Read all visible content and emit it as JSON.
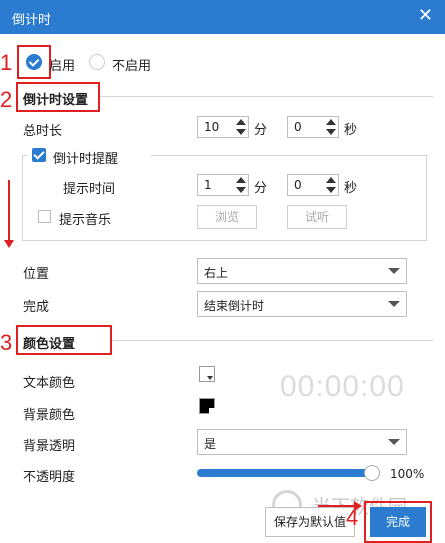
{
  "window": {
    "title": "倒计时",
    "close_glyph": "✕"
  },
  "annotations": {
    "n1": "1",
    "n2": "2",
    "n3": "3",
    "n4": "4"
  },
  "enable": {
    "on_label": "启用",
    "off_label": "不启用"
  },
  "countdown_settings": {
    "title": "倒计时设置",
    "total_label": "总时长",
    "total_min": "10",
    "min_unit": "分",
    "total_sec": "0",
    "sec_unit": "秒",
    "reminder_label": "倒计时提醒",
    "prompt_time_label": "提示时间",
    "prompt_min": "1",
    "prompt_sec": "0",
    "music_label": "提示音乐",
    "browse_label": "浏览",
    "listen_label": "试听",
    "position_label": "位置",
    "position_value": "右上",
    "complete_label": "完成",
    "complete_value": "结束倒计时"
  },
  "color_settings": {
    "title": "颜色设置",
    "text_color_label": "文本颜色",
    "bg_color_label": "背景颜色",
    "bg_transparent_label": "背景透明",
    "bg_transparent_value": "是",
    "opacity_label": "不透明度",
    "opacity_value": "100%",
    "preview_text": "00:00:00"
  },
  "footer": {
    "save_default_label": "保存为默认值",
    "done_label": "完成"
  },
  "watermark": {
    "text": "当下软件园"
  },
  "colors": {
    "accent": "#2b7bd1",
    "annotation": "#e02020"
  },
  "opacity_fraction": 1.0
}
